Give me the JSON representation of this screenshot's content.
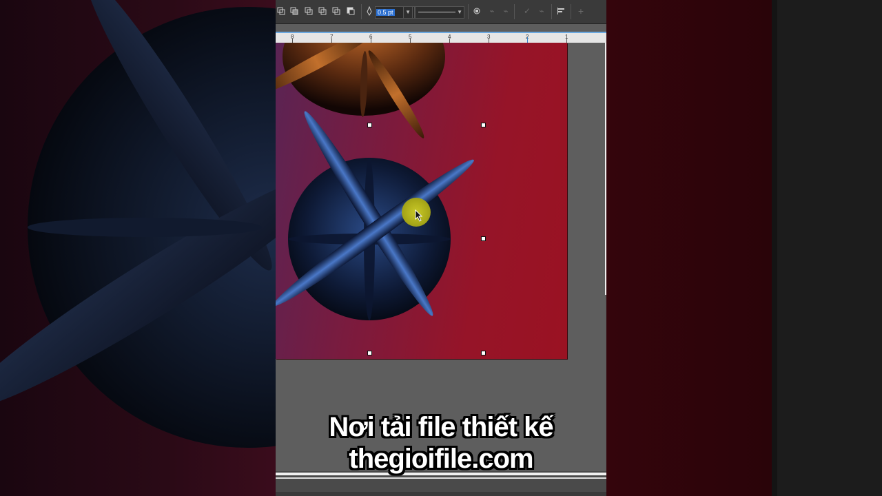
{
  "toolbar": {
    "outline_width": "0.5 pt",
    "icons": [
      "combine-icon",
      "weld-icon",
      "trim-icon",
      "intersect-icon",
      "simplify-icon",
      "back-minus-front-icon",
      "outline-pen-icon",
      "line-style-icon",
      "wrap-text-icon",
      "convert-to-curves-icon",
      "align-icon",
      "add-icon"
    ]
  },
  "ruler": {
    "labels": [
      "8",
      "7",
      "6",
      "5",
      "4",
      "3",
      "2",
      "1"
    ]
  },
  "caption": {
    "line1": "Nơi tải file thiết kế",
    "line2": "thegioifile.com"
  },
  "colors": {
    "page_gradient_start": "#5a2454",
    "page_gradient_end": "#9a1222",
    "selection_handle": "#ffffff",
    "cursor_halo": "#b8b820"
  }
}
